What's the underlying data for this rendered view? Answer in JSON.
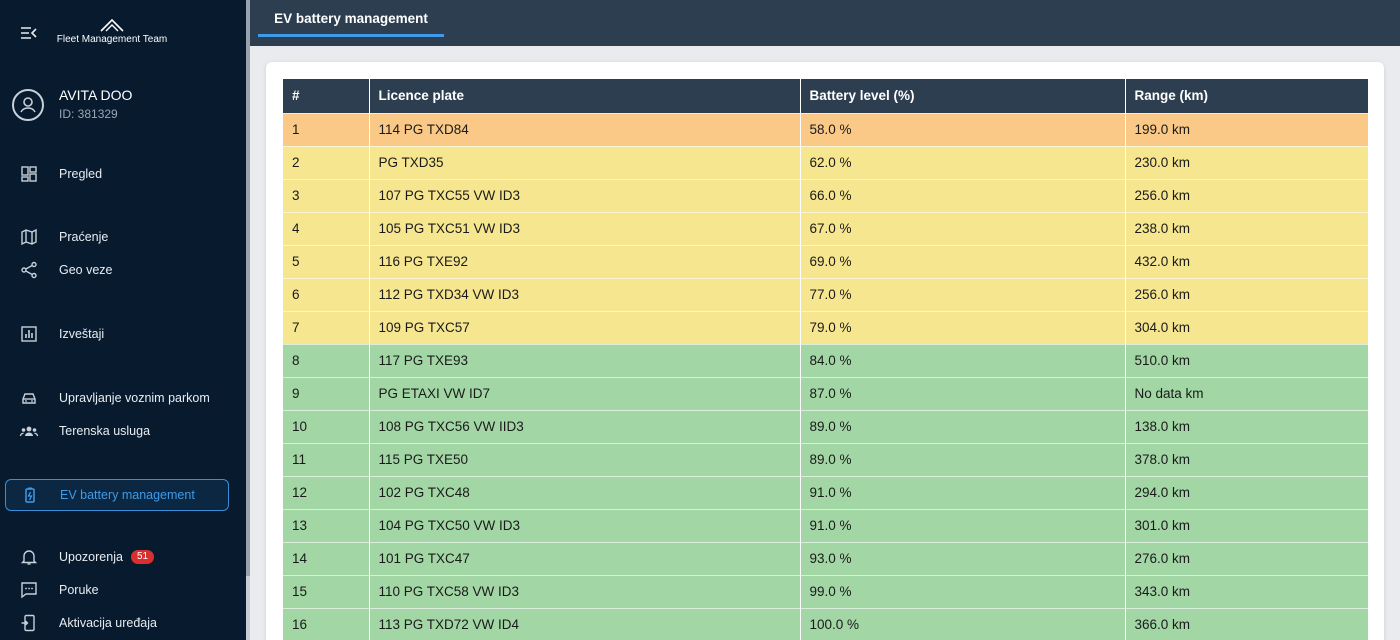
{
  "sidebar": {
    "logo_text": "Fleet Management Team",
    "user": {
      "name": "AVITA DOO",
      "id": "ID: 381329"
    },
    "items": [
      {
        "key": "pregled",
        "label": "Pregled",
        "icon": "dashboard-icon"
      },
      {
        "key": "pracenje",
        "label": "Praćenje",
        "icon": "map-icon"
      },
      {
        "key": "geo-veze",
        "label": "Geo veze",
        "icon": "share-icon"
      },
      {
        "key": "izvestaji",
        "label": "Izveštaji",
        "icon": "bar-chart-icon"
      },
      {
        "key": "upravljanje",
        "label": "Upravljanje voznim parkom",
        "icon": "car-icon"
      },
      {
        "key": "terenska",
        "label": "Terenska usluga",
        "icon": "team-icon"
      },
      {
        "key": "ev",
        "label": "EV battery management",
        "icon": "battery-icon",
        "active": true
      },
      {
        "key": "upozorenja",
        "label": "Upozorenja",
        "icon": "bell-icon",
        "badge": "51"
      },
      {
        "key": "poruke",
        "label": "Poruke",
        "icon": "message-icon"
      },
      {
        "key": "aktivacija",
        "label": "Aktivacija uređaja",
        "icon": "device-icon"
      }
    ]
  },
  "header": {
    "tab_label": "EV battery management"
  },
  "table": {
    "columns": [
      "#",
      "Licence plate",
      "Battery level (%)",
      "Range (km)"
    ],
    "rows": [
      {
        "n": "1",
        "plate": "114 PG TXD84",
        "battery": "58.0 %",
        "range": "199.0 km",
        "level": "orange"
      },
      {
        "n": "2",
        "plate": "PG TXD35",
        "battery": "62.0 %",
        "range": "230.0 km",
        "level": "yellow"
      },
      {
        "n": "3",
        "plate": "107 PG TXC55 VW ID3",
        "battery": "66.0 %",
        "range": "256.0 km",
        "level": "yellow"
      },
      {
        "n": "4",
        "plate": "105 PG TXC51 VW ID3",
        "battery": "67.0 %",
        "range": "238.0 km",
        "level": "yellow"
      },
      {
        "n": "5",
        "plate": "116 PG TXE92",
        "battery": "69.0 %",
        "range": "432.0 km",
        "level": "yellow"
      },
      {
        "n": "6",
        "plate": "112 PG TXD34 VW ID3",
        "battery": "77.0 %",
        "range": "256.0 km",
        "level": "yellow"
      },
      {
        "n": "7",
        "plate": "109 PG TXC57",
        "battery": "79.0 %",
        "range": "304.0 km",
        "level": "yellow"
      },
      {
        "n": "8",
        "plate": "117 PG TXE93",
        "battery": "84.0 %",
        "range": "510.0 km",
        "level": "green"
      },
      {
        "n": "9",
        "plate": "PG ETAXI VW ID7",
        "battery": "87.0 %",
        "range": "No data km",
        "level": "green"
      },
      {
        "n": "10",
        "plate": "108 PG TXC56 VW IID3",
        "battery": "89.0 %",
        "range": "138.0 km",
        "level": "green"
      },
      {
        "n": "11",
        "plate": "115 PG TXE50",
        "battery": "89.0 %",
        "range": "378.0 km",
        "level": "green"
      },
      {
        "n": "12",
        "plate": "102 PG TXC48",
        "battery": "91.0 %",
        "range": "294.0 km",
        "level": "green"
      },
      {
        "n": "13",
        "plate": "104 PG TXC50 VW ID3",
        "battery": "91.0 %",
        "range": "301.0 km",
        "level": "green"
      },
      {
        "n": "14",
        "plate": "101 PG TXC47",
        "battery": "93.0 %",
        "range": "276.0 km",
        "level": "green"
      },
      {
        "n": "15",
        "plate": "110 PG TXC58 VW ID3",
        "battery": "99.0 %",
        "range": "343.0 km",
        "level": "green"
      },
      {
        "n": "16",
        "plate": "113 PG TXD72 VW ID4",
        "battery": "100.0 %",
        "range": "366.0 km",
        "level": "green"
      }
    ]
  },
  "colors": {
    "sidebar_bg": "#071a2e",
    "header_bg": "#2c3e50",
    "accent": "#3d9be9",
    "orange": "#fbc987",
    "yellow": "#f7e690",
    "green": "#a3d6a5"
  }
}
